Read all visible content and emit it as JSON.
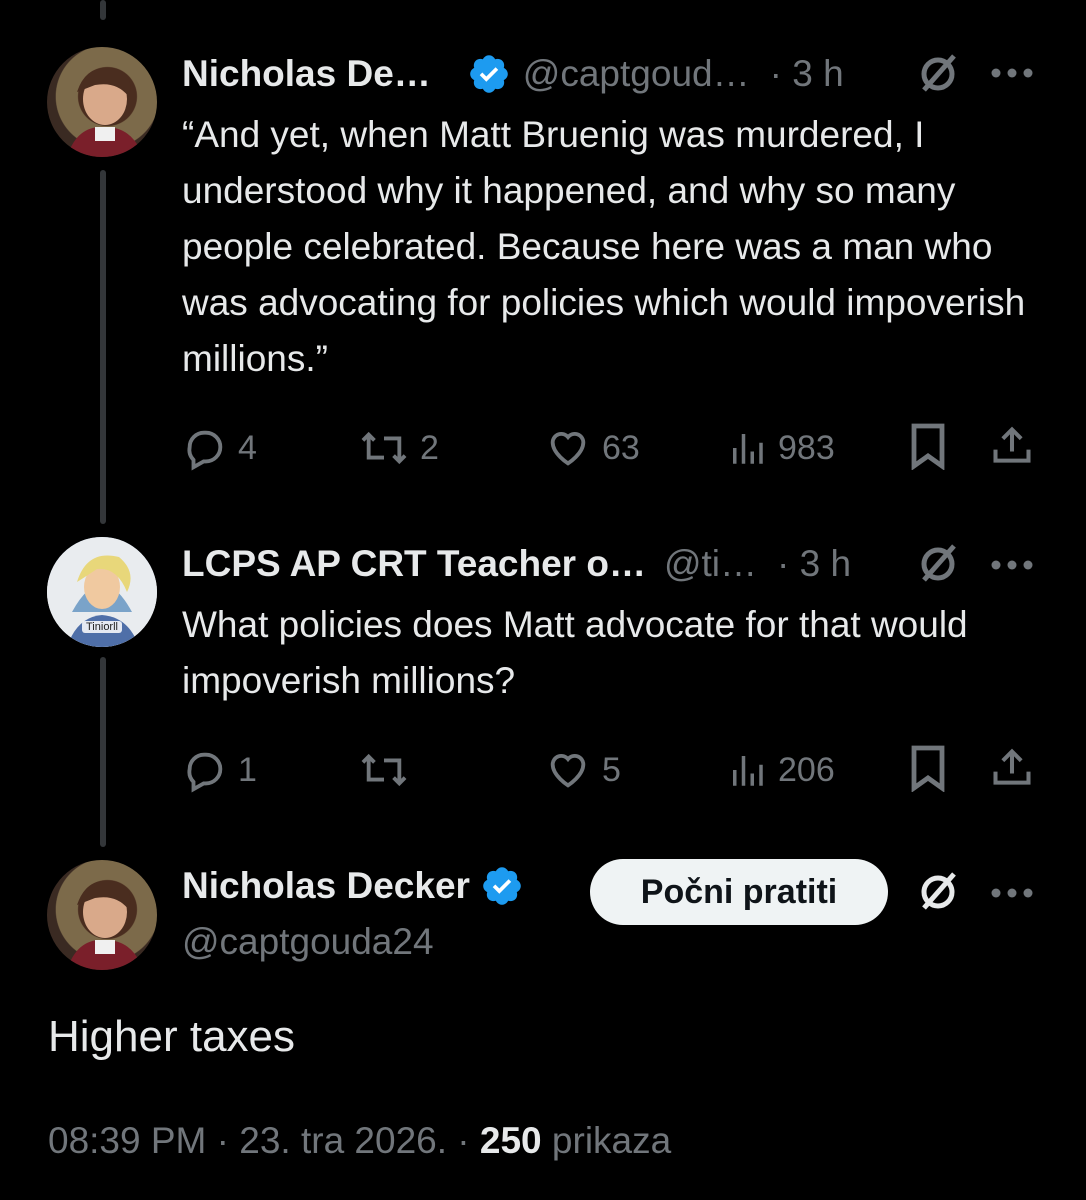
{
  "tweets": [
    {
      "name": "Nicholas De…",
      "handle": "@captgoud…",
      "time": "· 3 h",
      "text": "“And yet, when Matt Bruenig was murdered, I understood why it happened, and why so many people celebrated. Because here was a man who was advocating for policies which would impoverish millions.”",
      "replies": "4",
      "reposts": "2",
      "likes": "63",
      "views": "983"
    },
    {
      "name": "LCPS AP CRT Teacher o…",
      "handle": "@ti…",
      "time": "· 3 h",
      "avatar_label": "Tiniorll",
      "text": "What policies does Matt advocate for that would impoverish millions?",
      "replies": "1",
      "reposts": "",
      "likes": "5",
      "views": "206"
    }
  ],
  "main": {
    "name": "Nicholas Decker",
    "handle": "@captgouda24",
    "follow_label": "Počni pratiti",
    "text": "Higher taxes",
    "timestamp": "08:39 PM · 23. tra 2026. ·",
    "views_count": "250",
    "views_label": "prikaza"
  },
  "colors": {
    "background": "#000000",
    "text": "#e7e9ea",
    "muted": "#71767b",
    "verified": "#1d9bf0"
  },
  "icons": [
    "verified-badge-icon",
    "grok-icon",
    "more-icon",
    "reply-icon",
    "repost-icon",
    "like-icon",
    "views-icon",
    "bookmark-icon",
    "share-icon"
  ]
}
